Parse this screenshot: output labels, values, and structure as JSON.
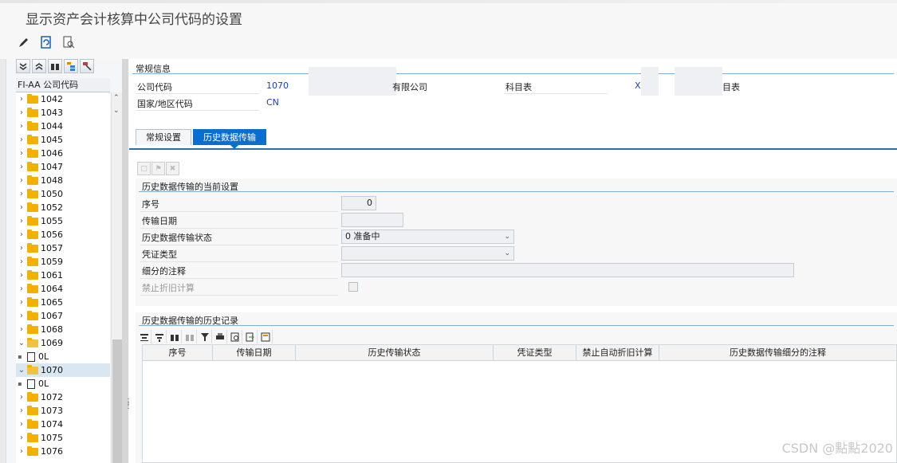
{
  "window": {
    "title": "显示资产会计核算中公司代码的设置"
  },
  "left_panel": {
    "header": "FI-AA 公司代码",
    "nodes": [
      {
        "label": "1042",
        "kind": "folder",
        "state": "collapsed"
      },
      {
        "label": "1043",
        "kind": "folder",
        "state": "collapsed"
      },
      {
        "label": "1044",
        "kind": "folder",
        "state": "collapsed"
      },
      {
        "label": "1045",
        "kind": "folder",
        "state": "collapsed"
      },
      {
        "label": "1046",
        "kind": "folder",
        "state": "collapsed"
      },
      {
        "label": "1047",
        "kind": "folder",
        "state": "collapsed"
      },
      {
        "label": "1048",
        "kind": "folder",
        "state": "collapsed"
      },
      {
        "label": "1050",
        "kind": "folder",
        "state": "collapsed"
      },
      {
        "label": "1052",
        "kind": "folder",
        "state": "collapsed"
      },
      {
        "label": "1055",
        "kind": "folder",
        "state": "collapsed"
      },
      {
        "label": "1056",
        "kind": "folder",
        "state": "collapsed"
      },
      {
        "label": "1057",
        "kind": "folder",
        "state": "collapsed"
      },
      {
        "label": "1059",
        "kind": "folder",
        "state": "collapsed"
      },
      {
        "label": "1061",
        "kind": "folder",
        "state": "collapsed"
      },
      {
        "label": "1064",
        "kind": "folder",
        "state": "collapsed"
      },
      {
        "label": "1065",
        "kind": "folder",
        "state": "collapsed"
      },
      {
        "label": "1067",
        "kind": "folder",
        "state": "collapsed"
      },
      {
        "label": "1068",
        "kind": "folder",
        "state": "collapsed"
      },
      {
        "label": "1069",
        "kind": "folder",
        "state": "expanded"
      },
      {
        "label": "0L",
        "kind": "doc"
      },
      {
        "label": "1070",
        "kind": "folder",
        "state": "expanded",
        "selected": true
      },
      {
        "label": "0L",
        "kind": "doc"
      },
      {
        "label": "1072",
        "kind": "folder",
        "state": "collapsed"
      },
      {
        "label": "1073",
        "kind": "folder",
        "state": "collapsed"
      },
      {
        "label": "1074",
        "kind": "folder",
        "state": "collapsed"
      },
      {
        "label": "1075",
        "kind": "folder",
        "state": "collapsed"
      },
      {
        "label": "1076",
        "kind": "folder",
        "state": "collapsed"
      }
    ]
  },
  "general_info": {
    "section_title": "常规信息",
    "company_code_label": "公司代码",
    "company_code_value": "1070",
    "company_name_suffix": "有限公司",
    "chart_of_accounts_label": "科目表",
    "chart_of_accounts_value": "X",
    "chart_desc_suffix": "目表",
    "country_label": "国家/地区代码",
    "country_value": "CN"
  },
  "tabs": [
    {
      "label": "常规设置",
      "active": false
    },
    {
      "label": "历史数据传输",
      "active": true
    }
  ],
  "current_settings": {
    "section_title": "历史数据传输的当前设置",
    "seq_label": "序号",
    "seq_value": "0",
    "date_label": "传输日期",
    "date_value": "",
    "status_label": "历史数据传输状态",
    "status_value": "0 准备中",
    "doc_type_label": "凭证类型",
    "doc_type_value": "",
    "note_label": "细分的注释",
    "note_value": "",
    "block_depr_label": "禁止折旧计算"
  },
  "history": {
    "section_title": "历史数据传输的历史记录",
    "columns": [
      "序号",
      "传输日期",
      "历史传输状态",
      "凭证类型",
      "禁止自动折旧计算",
      "历史数据传输细分的注释"
    ]
  },
  "watermark": "CSDN @點點2020"
}
